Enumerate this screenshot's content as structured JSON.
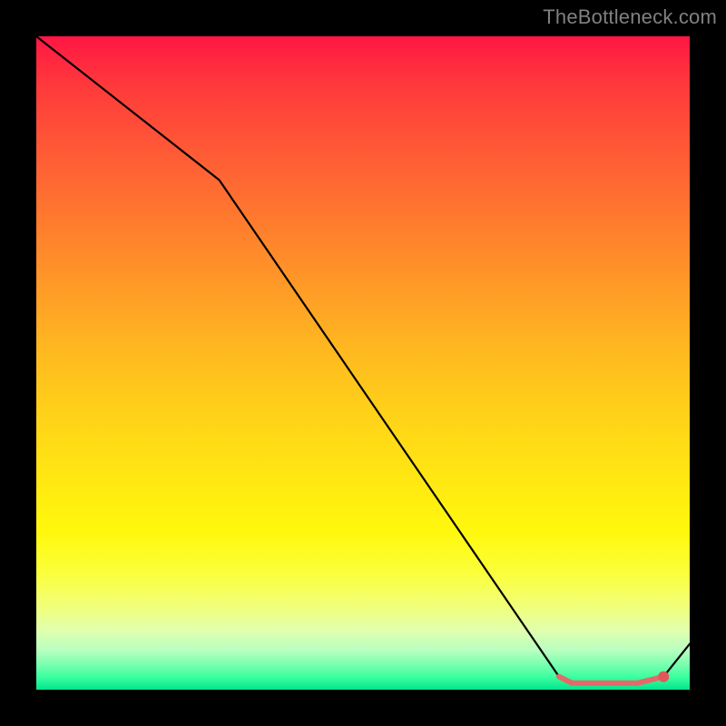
{
  "watermark": "TheBottleneck.com",
  "colors": {
    "background": "#000000",
    "curve": "#000000",
    "optimal_stroke": "#e46a6a",
    "optimal_dot": "#e05858",
    "gradient_top": "#ff1744",
    "gradient_bottom": "#00e68c"
  },
  "chart_data": {
    "type": "line",
    "title": "",
    "xlabel": "",
    "ylabel": "",
    "xlim": [
      0,
      100
    ],
    "ylim": [
      0,
      100
    ],
    "series": [
      {
        "name": "bottleneck-curve",
        "x": [
          0,
          28,
          80,
          82,
          92,
          96,
          100
        ],
        "y": [
          100,
          78,
          2,
          1,
          1,
          2,
          7
        ]
      },
      {
        "name": "optimal-range",
        "x": [
          80,
          82,
          92,
          96
        ],
        "y": [
          2,
          1,
          1,
          2
        ]
      }
    ],
    "markers": [
      {
        "name": "optimal-end-dot",
        "x": 96,
        "y": 2
      }
    ]
  }
}
